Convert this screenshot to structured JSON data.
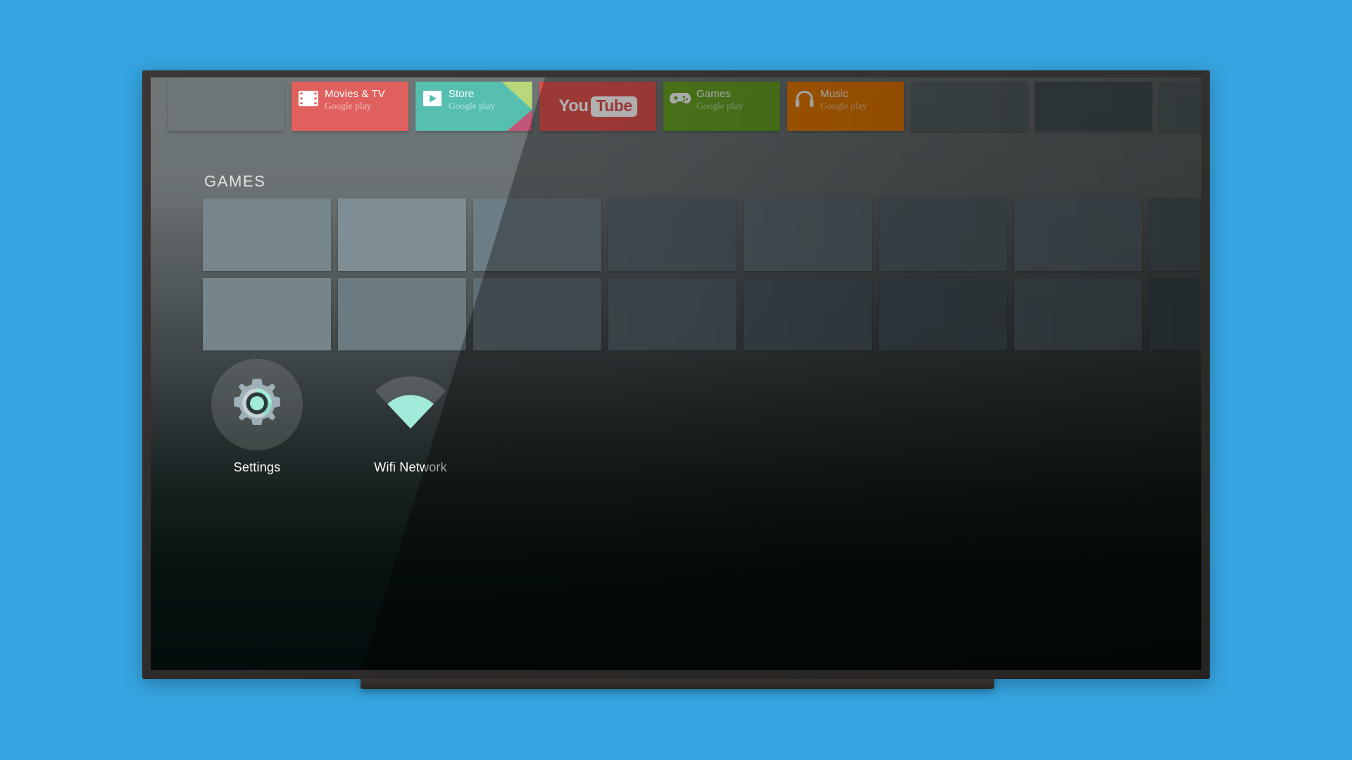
{
  "page": {
    "background_color": "#35a4e0",
    "device": "television",
    "os_name": "Android TV Home Screen"
  },
  "colors": {
    "backdrop": "#35a4e0",
    "bezel": "#332f2e",
    "screen_top": "#6f7779",
    "screen_bottom": "#030c0c",
    "movies_tile": "#e0605e",
    "store_tile": "#56bfb0",
    "youtube_tile": "#e0524f",
    "games_tile": "#6aa725",
    "music_tile": "#ef7e00",
    "placeholder_tile": "#5c696d",
    "accent_teal": "#a2ead9",
    "label_white": "#ffffff"
  },
  "app_row": {
    "name": "top-app-row",
    "tiles": [
      {
        "id": "ghost-left",
        "kind": "ghost",
        "title": "",
        "subtitle": "",
        "icon": ""
      },
      {
        "id": "movies-tv",
        "kind": "app",
        "title": "Movies & TV",
        "subtitle": "Google play",
        "icon": "film-strip-icon",
        "color": "#e0605e"
      },
      {
        "id": "store",
        "kind": "app",
        "title": "Store",
        "subtitle": "Google play",
        "icon": "play-store-icon",
        "color": "#56bfb0"
      },
      {
        "id": "youtube",
        "kind": "logo",
        "title": "YouTube",
        "subtitle": "",
        "logo_part_a": "You",
        "logo_part_b": "Tube",
        "icon": "youtube-logo-icon",
        "color": "#e0524f"
      },
      {
        "id": "games",
        "kind": "app",
        "title": "Games",
        "subtitle": "Google play",
        "icon": "gamepad-icon",
        "color": "#6aa725"
      },
      {
        "id": "music",
        "kind": "app",
        "title": "Music",
        "subtitle": "Google play",
        "icon": "headphones-icon",
        "color": "#ef7e00"
      },
      {
        "id": "slot-7",
        "kind": "placeholder",
        "title": "",
        "subtitle": "",
        "icon": ""
      },
      {
        "id": "slot-8",
        "kind": "placeholder",
        "title": "",
        "subtitle": "",
        "icon": ""
      },
      {
        "id": "slot-9",
        "kind": "placeholder",
        "title": "",
        "subtitle": "",
        "icon": ""
      }
    ]
  },
  "games_section": {
    "heading": "GAMES",
    "row_1": [
      {
        "id": "g1-1",
        "label": ""
      },
      {
        "id": "g1-2",
        "label": ""
      },
      {
        "id": "g1-3",
        "label": ""
      },
      {
        "id": "g1-4",
        "label": ""
      },
      {
        "id": "g1-5",
        "label": ""
      },
      {
        "id": "g1-6",
        "label": ""
      },
      {
        "id": "g1-7",
        "label": ""
      },
      {
        "id": "g1-8",
        "label": ""
      }
    ],
    "row_2": [
      {
        "id": "g2-1",
        "label": ""
      },
      {
        "id": "g2-2",
        "label": ""
      },
      {
        "id": "g2-3",
        "label": ""
      },
      {
        "id": "g2-4",
        "label": ""
      },
      {
        "id": "g2-5",
        "label": ""
      },
      {
        "id": "g2-6",
        "label": ""
      },
      {
        "id": "g2-7",
        "label": ""
      },
      {
        "id": "g2-8",
        "label": ""
      }
    ]
  },
  "shortcuts": [
    {
      "id": "settings",
      "label": "Settings",
      "icon": "gear-icon"
    },
    {
      "id": "wifi",
      "label": "Wifi Network",
      "icon": "wifi-signal-icon"
    }
  ]
}
